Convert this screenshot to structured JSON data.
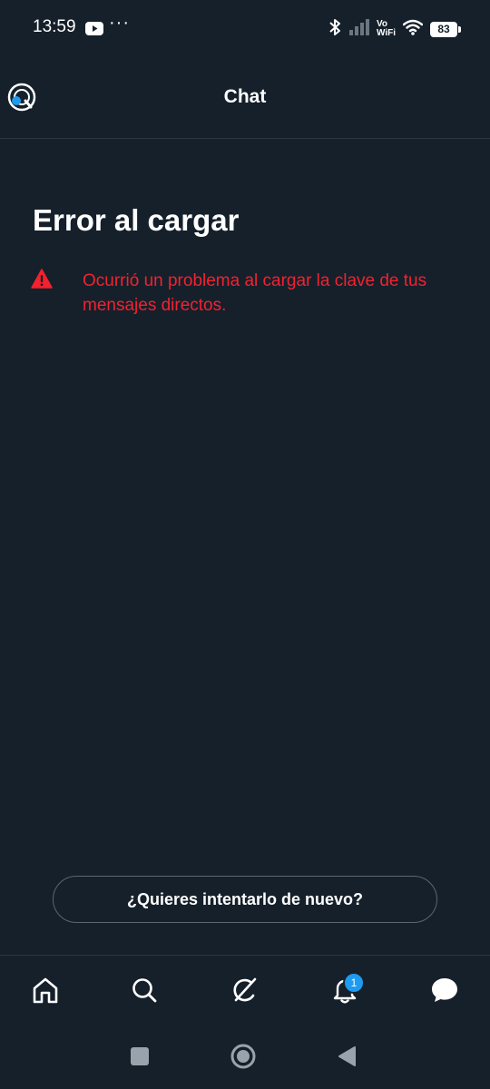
{
  "status_bar": {
    "time": "13:59",
    "dots": "···",
    "vowifi_top": "Vo",
    "vowifi_bottom": "WiFi",
    "battery": "83"
  },
  "header": {
    "title": "Chat"
  },
  "error": {
    "title": "Error al cargar",
    "message": "Ocurrió un problema al cargar la clave de tus mensajes directos."
  },
  "retry": {
    "label": "¿Quieres intentarlo de nuevo?"
  },
  "bottom_nav": {
    "items": [
      {
        "icon": "home-icon"
      },
      {
        "icon": "search-icon"
      },
      {
        "icon": "grok-icon"
      },
      {
        "icon": "notifications-icon",
        "badge": "1"
      },
      {
        "icon": "messages-icon"
      }
    ]
  },
  "colors": {
    "background": "#15202b",
    "error": "#f4212e",
    "accent": "#1d9bf0"
  }
}
